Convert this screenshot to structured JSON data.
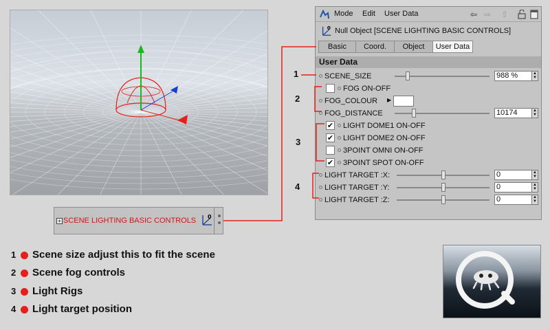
{
  "object_manager": {
    "object_name": "SCENE LIGHTING BASIC  CONTROLS",
    "tag_icon": "null-object-icon"
  },
  "attribute_manager": {
    "menu": {
      "mode": "Mode",
      "edit": "Edit",
      "user_data": "User Data"
    },
    "nav_icons": [
      "back-arrow-icon",
      "forward-arrow-icon",
      "up-arrow-icon",
      "lock-icon",
      "new-window-icon"
    ],
    "title": "Null Object [SCENE LIGHTING BASIC  CONTROLS]",
    "tabs": [
      {
        "label": "Basic",
        "active": false
      },
      {
        "label": "Coord.",
        "active": false
      },
      {
        "label": "Object",
        "active": false
      },
      {
        "label": "User Data",
        "active": true
      }
    ],
    "section": "User Data",
    "params": {
      "scene_size": {
        "label": "SCENE_SIZE",
        "value": "988 %",
        "slider": 0.14
      },
      "fog_on_off": {
        "label": "FOG ON-OFF",
        "checked": false
      },
      "fog_colour": {
        "label": "FOG_COLOUR",
        "color": "#ffffff"
      },
      "fog_distance": {
        "label": "FOG_DISTANCE",
        "value": "10174",
        "slider": 0.2
      },
      "light_dome1": {
        "label": "LIGHT DOME1 ON-OFF",
        "checked": true
      },
      "light_dome2": {
        "label": "LIGHT DOME2 ON-OFF",
        "checked": true
      },
      "omni": {
        "label": "3POINT OMNI ON-OFF",
        "checked": false
      },
      "spot": {
        "label": "3POINT SPOT ON-OFF",
        "checked": true
      },
      "target_x": {
        "label": "LIGHT TARGET :X:",
        "value": "0",
        "slider": 0.5
      },
      "target_y": {
        "label": "LIGHT TARGET :Y:",
        "value": "0",
        "slider": 0.5
      },
      "target_z": {
        "label": "LIGHT TARGET :Z:",
        "value": "0",
        "slider": 0.5
      }
    }
  },
  "callouts": [
    "1",
    "2",
    "3",
    "4"
  ],
  "legend": [
    {
      "num": "1",
      "text": "Scene size adjust this to fit the scene"
    },
    {
      "num": "2",
      "text": "Scene fog controls"
    },
    {
      "num": "3",
      "text": "Light Rigs"
    },
    {
      "num": "4",
      "text": "Light target position"
    }
  ],
  "colors": {
    "accent_red": "#e3201b",
    "panel_bg": "#c5c5c5",
    "page_bg": "#d7d7d7"
  }
}
